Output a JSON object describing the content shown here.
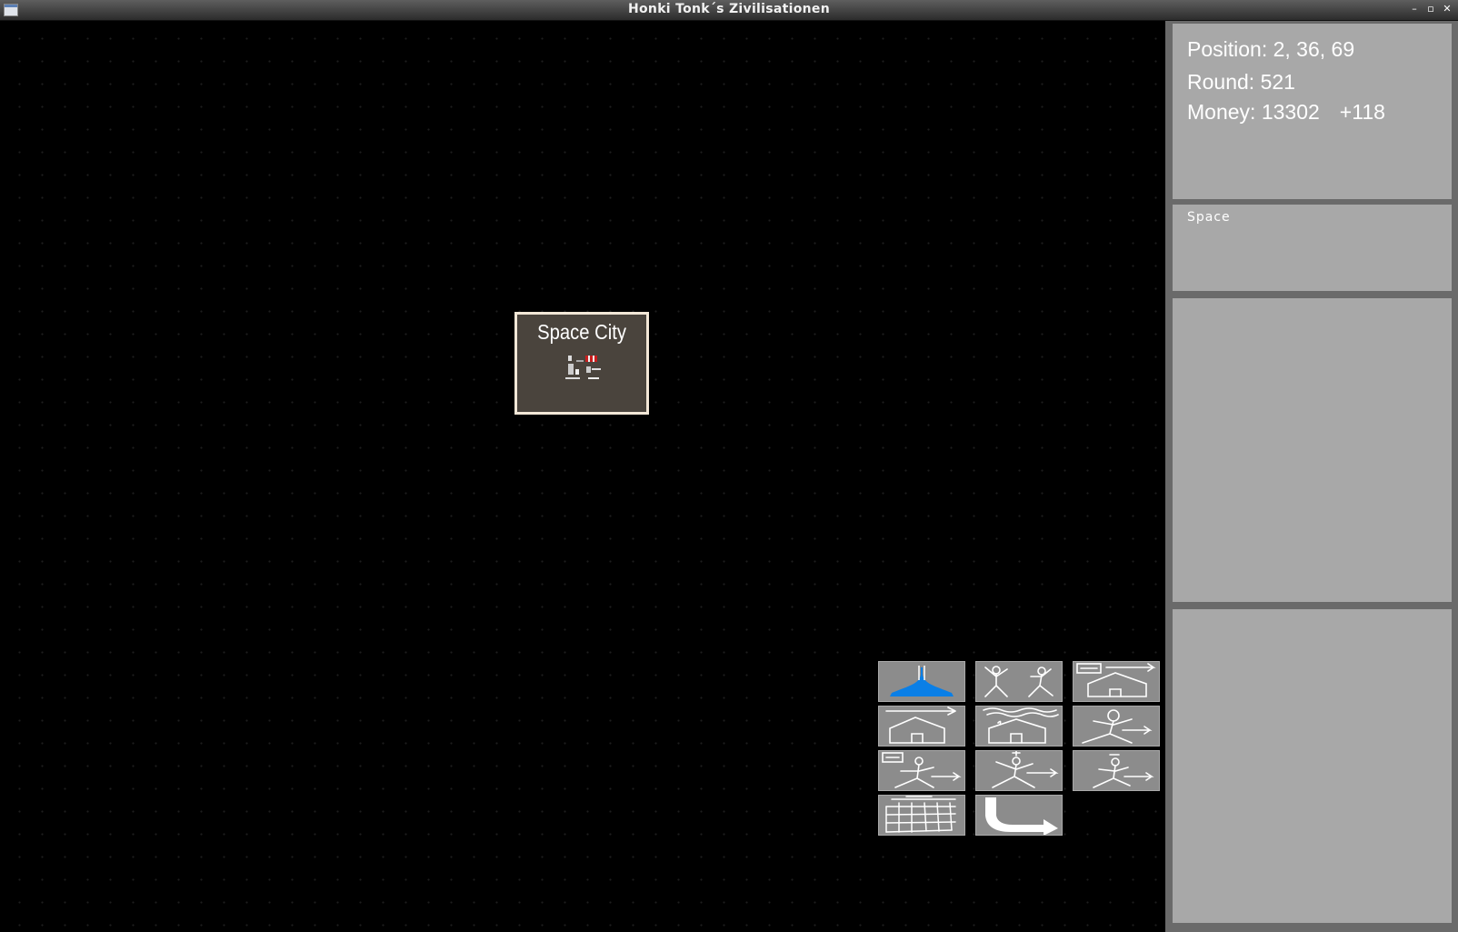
{
  "window": {
    "title": "Honki Tonk´s Zivilisationen",
    "controls": {
      "minimize": "–",
      "maximize": "▫",
      "close": "✕"
    }
  },
  "map": {
    "city": {
      "name": "Space City",
      "icon": "space-city-icon"
    }
  },
  "actions": [
    {
      "name": "water-drop-button",
      "icon": "water-drop-icon",
      "accent": "#0a7fe6"
    },
    {
      "name": "two-people-button",
      "icon": "two-people-icon"
    },
    {
      "name": "message-house-button",
      "icon": "message-house-icon"
    },
    {
      "name": "house-arrow-button",
      "icon": "house-arrow-icon"
    },
    {
      "name": "house-waves-button",
      "icon": "house-waves-icon"
    },
    {
      "name": "person-arrow-button",
      "icon": "person-arrow-icon"
    },
    {
      "name": "message-person-arrow-button",
      "icon": "message-person-arrow-icon"
    },
    {
      "name": "person-crossed-arrow-button",
      "icon": "person-crossed-arrow-icon"
    },
    {
      "name": "person-small-arrow-button",
      "icon": "person-small-arrow-icon"
    },
    {
      "name": "grid-field-button",
      "icon": "grid-field-icon"
    },
    {
      "name": "end-turn-button",
      "icon": "curved-arrow-icon"
    }
  ],
  "info": {
    "position_label": "Position:",
    "position_value": "2, 36, 69",
    "round_label": "Round:",
    "round_value": "521",
    "money_label": "Money:",
    "money_value": "13302",
    "money_income": "+118"
  },
  "terrain": {
    "name": "Space"
  },
  "colors": {
    "panel": "#a8a8a8",
    "panel_border": "#6a6a6a",
    "button": "#8c8c8c",
    "city_bg": "#4a443d",
    "city_border": "#f2e7d7"
  }
}
